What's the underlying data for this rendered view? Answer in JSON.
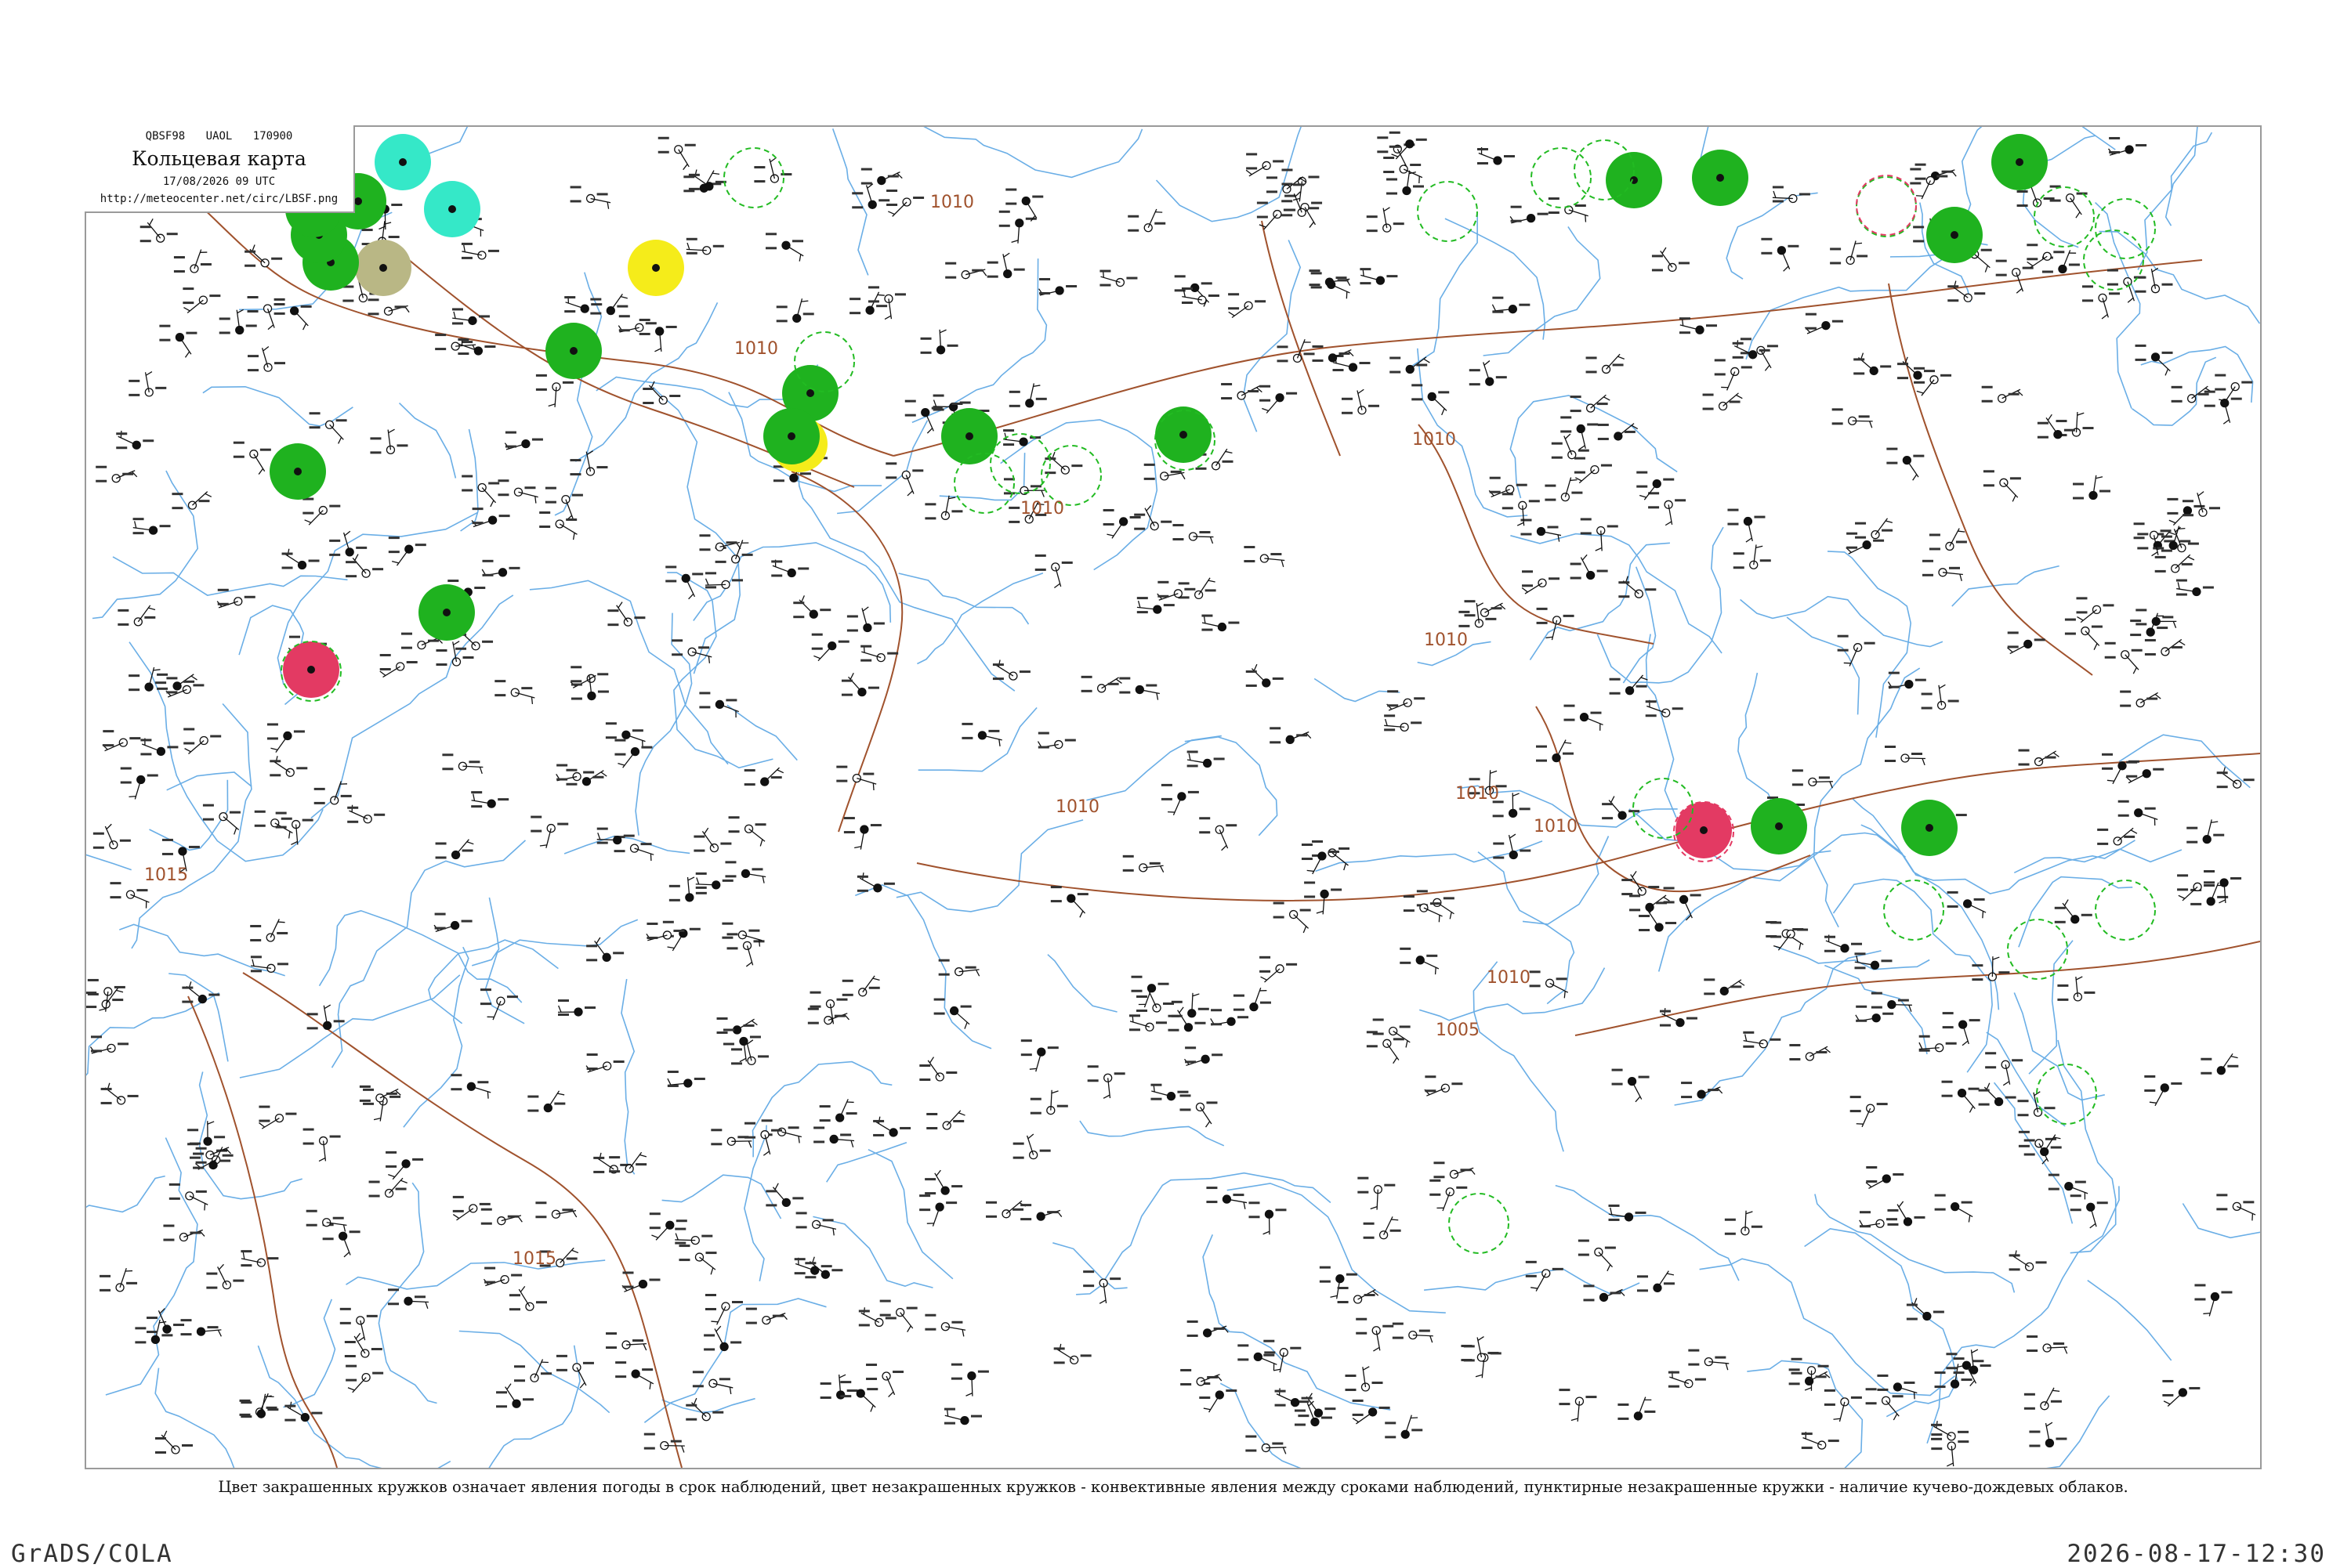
{
  "header": {
    "code_line": "QBSF98 UAOL 170900",
    "title": "Кольцевая карта",
    "datetime": "17/08/2026 09 UTC",
    "url": "http://meteocenter.net/circ/LBSF.png"
  },
  "legend_text": "Цвет закрашенных кружков означает явления погоды в срок наблюдений, цвет незакрашенных кружков - конвективные явления между сроками наблюдений, пунктирные незакрашенные кружки - наличие кучево-дождевых облаков.",
  "footer": {
    "left": "GrADS/COLA",
    "right": "2026-08-17-12:30"
  },
  "isobar_labels": [
    "1010",
    "1010",
    "1010",
    "1010",
    "1010",
    "1010",
    "1010",
    "1010",
    "1015",
    "1015",
    "1005",
    "1010"
  ],
  "colors": {
    "coast": "#6aaee6",
    "isobar": "#a0522d",
    "phenomenon_green": "#1fb21f",
    "phenomenon_cyan": "#35e8c8",
    "phenomenon_yellow": "#f5ec1a",
    "phenomenon_red": "#e33a63",
    "phenomenon_olive": "#b9b785",
    "convective_green": "#22bb22",
    "convective_red": "#e33a63"
  },
  "icons": [
    "station-circle-icon",
    "wind-barb-icon",
    "precipitation-circle-icon",
    "cumulonimbus-circle-icon"
  ]
}
